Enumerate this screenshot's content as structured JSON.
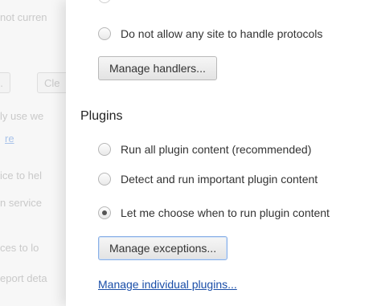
{
  "background": {
    "lines": [
      "not curren",
      "ly use we",
      "ice to hel",
      "n service",
      "ces to lo",
      "eport deta"
    ],
    "link": "re",
    "buttons": [
      "...",
      "Cle"
    ]
  },
  "protocols": {
    "deny_option": "Do not allow any site to handle protocols",
    "manage_button": "Manage handlers..."
  },
  "plugins": {
    "title": "Plugins",
    "options": [
      {
        "label": "Run all plugin content (recommended)",
        "checked": false
      },
      {
        "label": "Detect and run important plugin content",
        "checked": false
      },
      {
        "label": "Let me choose when to run plugin content",
        "checked": true
      }
    ],
    "manage_button": "Manage exceptions...",
    "individual_link": "Manage individual plugins..."
  }
}
